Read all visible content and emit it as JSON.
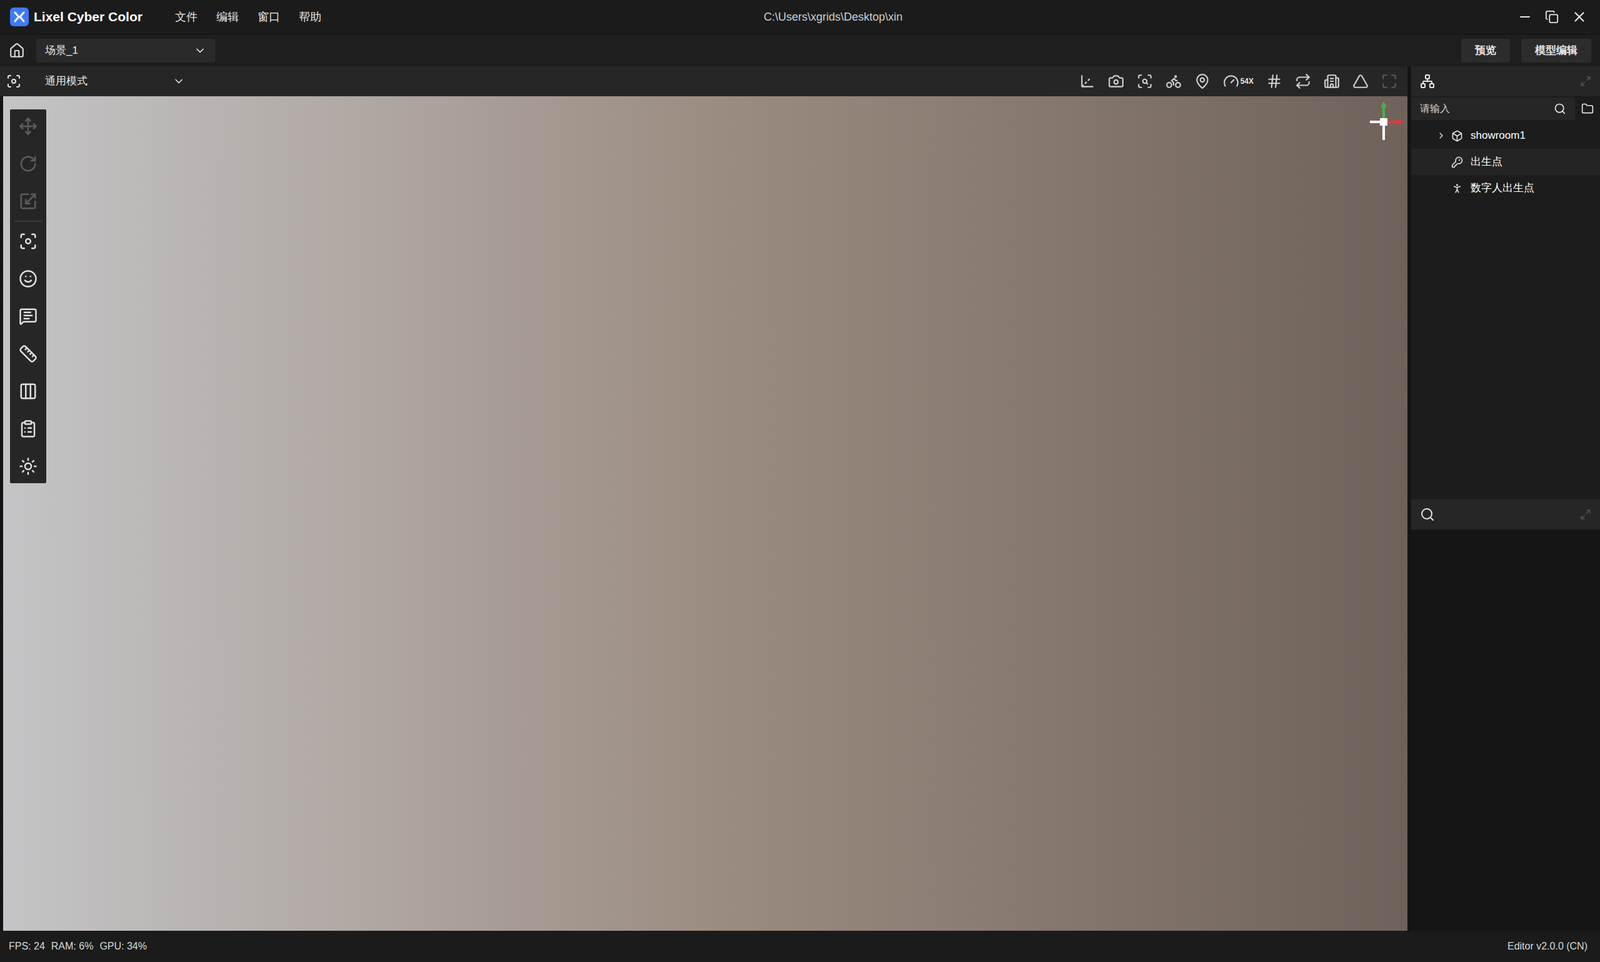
{
  "app": {
    "name": "Lixel Cyber Color"
  },
  "menu": [
    "文件",
    "编辑",
    "窗口",
    "帮助"
  ],
  "window": {
    "title": "C:\\Users\\xgrids\\Desktop\\xin"
  },
  "scene_selector": {
    "value": "场景_1"
  },
  "header_buttons": [
    "预览",
    "模型编辑"
  ],
  "view_mode": {
    "value": "通用模式"
  },
  "toolbar": {
    "speed_label": "54X"
  },
  "left_tools": [
    {
      "kind": "move",
      "disabled": true
    },
    {
      "kind": "rotate",
      "disabled": true
    },
    {
      "kind": "scale",
      "disabled": true
    },
    {
      "kind": "focus",
      "disabled": false
    },
    {
      "kind": "avatar",
      "disabled": false
    },
    {
      "kind": "annotation",
      "disabled": false
    },
    {
      "kind": "measure",
      "disabled": false
    },
    {
      "kind": "clip",
      "disabled": false
    },
    {
      "kind": "list",
      "disabled": false
    },
    {
      "kind": "ai",
      "disabled": false
    }
  ],
  "outliner": {
    "search_placeholder": "请输入",
    "items": [
      {
        "label": "showroom1",
        "kind": "model",
        "expandable": true,
        "expanded": false,
        "selected": false
      },
      {
        "label": "出生点",
        "kind": "spawn",
        "expandable": false,
        "expanded": false,
        "selected": true
      },
      {
        "label": "数字人出生点",
        "kind": "avatar",
        "expandable": false,
        "expanded": false,
        "selected": false
      }
    ]
  },
  "status_bar": {
    "fps": "FPS: 24",
    "ram": "RAM: 6%",
    "gpu": "GPU: 34%",
    "version": "Editor v2.0.0 (CN)"
  }
}
